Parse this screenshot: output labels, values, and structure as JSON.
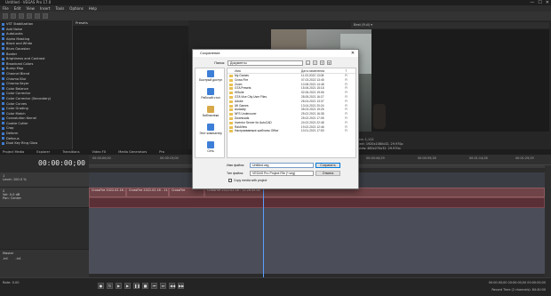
{
  "app": {
    "title": "Untitled - VEGAS Pro 17.0",
    "controls": [
      "—",
      "☐",
      "✕"
    ]
  },
  "menu": [
    "File",
    "Edit",
    "View",
    "Insert",
    "Tools",
    "Options",
    "Help"
  ],
  "fx_tree": [
    "VST Stabilization",
    "Add Noise",
    "AutoLooks",
    "Alpha Masking",
    "Black and White",
    "Blurs Gaussian",
    "Border",
    "Brightness and Contrast",
    "Broadcast Colors",
    "Bump Map",
    "Channel Blend",
    "Chroma Blur",
    "Chroma Keyer",
    "Color Balance",
    "Color Corrector",
    "Color Corrector (Secondary)",
    "Color Curves",
    "Color Grading",
    "Color Match",
    "Convolution Kernel",
    "Cookie Cutter",
    "Crop",
    "Deform",
    "Defocus",
    "Dual Key Ring Glow"
  ],
  "presets_header": "Presets",
  "preview_header": "Best (Full)  ▾",
  "preview_info": [
    "Project: 1920x1080x32, 29.970p",
    "Preview: 480x270x32, 29.970p",
    "Display: 329x184x32"
  ],
  "preview_frame": "Frame: 1,112",
  "tabs": [
    "Project Media",
    "Explorer",
    "Transitions",
    "Video FX",
    "Media Generators",
    "Pro"
  ],
  "timecode": "00:00:00;00",
  "ruler_labels": [
    "00:00:00;00",
    "00:00:15;00",
    "00:00:29;29",
    "00:00:44;29",
    "00:00:59;28",
    "00:01:14;28",
    "00:01:29;29"
  ],
  "tracks": [
    {
      "num": "1",
      "level": "Level: 100.0 %"
    },
    {
      "num": "2",
      "vol": "Vol: 0.0 dB",
      "pan": "Pan: Center"
    }
  ],
  "clips": [
    "CrossFire 2022.02.16 - 11.25.56.01",
    "CrossFire 2022.02.16 - 11.26.06",
    "CrossFire",
    "CrossFire 2022.02.16 - 11.26.45.04"
  ],
  "master": {
    "label": "Master",
    "vals": [
      "-Inf.",
      "-Inf."
    ]
  },
  "rate": "Rate: 0.00",
  "transport_buttons": [
    "●",
    "↻",
    "▶",
    "▶",
    "❚❚",
    "■",
    "⏮",
    "⏭",
    "◀◀",
    "▶▶"
  ],
  "bottom_times": "00:00:00;00  00:00:00;00  00:00:00;00",
  "record_time": "Record Time (2 channels): 84:40:00",
  "dialog": {
    "title": "Сохранение",
    "folder_label": "Папка:",
    "folder": "Документы",
    "places": [
      "Быстрый доступ",
      "Рабочий стол",
      "Библиотеки",
      "Этот компьютер",
      "Сеть"
    ],
    "col_name": "Имя",
    "col_date": "Дата изменения",
    "col_type": "Т",
    "files": [
      {
        "n": "My Games",
        "d": "11.03.2022 13:08",
        "t": "Fi"
      },
      {
        "n": "Cross Fire",
        "d": "07.03.2022 13:45",
        "t": "Fi"
      },
      {
        "n": "Zoom",
        "d": "10.08.2021 14:48",
        "t": "Fi"
      },
      {
        "n": "GTA Presets",
        "d": "15.06.2021 15:18",
        "t": "Fi"
      },
      {
        "n": "HiSuite",
        "d": "02.06.2021 19:06",
        "t": "Fi"
      },
      {
        "n": "GTA Vice City User Files",
        "d": "28.05.2021 16:27",
        "t": "Fi"
      },
      {
        "n": "Adobe",
        "d": "26.04.2021 13:37",
        "t": "Fi"
      },
      {
        "n": "IW Games",
        "d": "13.04.2021 20:24",
        "t": "Fi"
      },
      {
        "n": "Audacity",
        "d": "05.03.2021 19:26",
        "t": "Fi"
      },
      {
        "n": "NFS Undercover",
        "d": "25.02.2021 16:38",
        "t": "Fi"
      },
      {
        "n": "Downloads",
        "d": "25.02.2021 17:05",
        "t": "Fi"
      },
      {
        "n": "Inventor Server for AutoCAD",
        "d": "24.02.2021 22:48",
        "t": "Fi"
      },
      {
        "n": "RaidView",
        "d": "19.02.2021 12:46",
        "t": "Fi"
      },
      {
        "n": "Настраиваемые шаблоны Office",
        "d": "10.01.2021 17:53",
        "t": "Fi"
      }
    ],
    "filename_label": "Имя файла:",
    "filename": "Untitled.veg",
    "filetype_label": "Тип файла:",
    "filetype": "VEGAS Pro Project File (*.veg)",
    "save": "Сохранить",
    "cancel": "Отмена",
    "copy_media": "Copy media with project"
  }
}
